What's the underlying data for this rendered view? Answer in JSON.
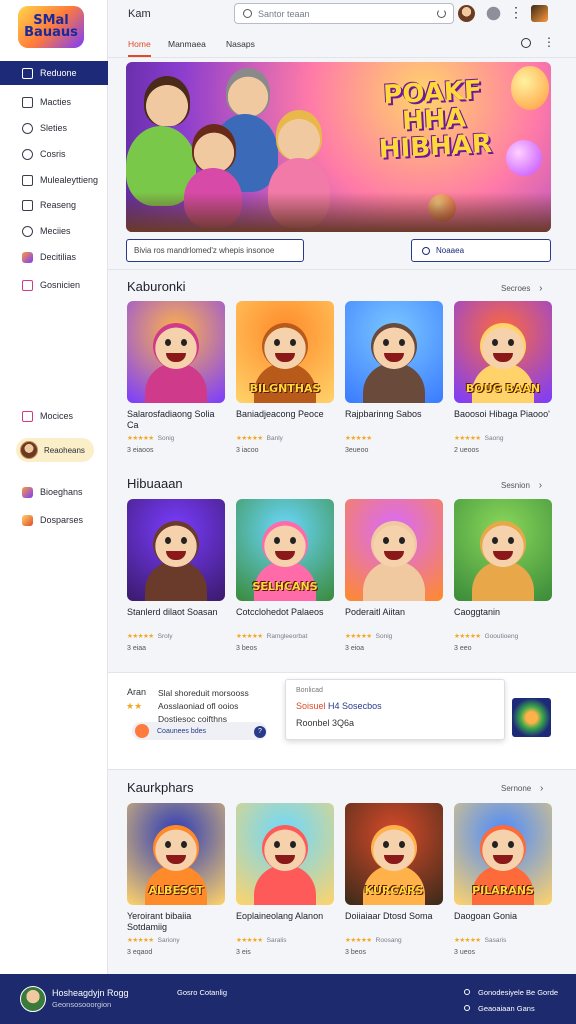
{
  "sidebar": {
    "logo_top": "SMal",
    "logo_bottom": "Bauaus",
    "items": [
      {
        "label": "Reduone",
        "icon": "home-icon"
      },
      {
        "label": "Macties",
        "icon": "grid-icon"
      },
      {
        "label": "Sleties",
        "icon": "clock-icon"
      },
      {
        "label": "Cosris",
        "icon": "chat-icon"
      },
      {
        "label": "Mulealeyttieng",
        "icon": "list-icon"
      },
      {
        "label": "Reaseng",
        "icon": "document-icon"
      },
      {
        "label": "Meciies",
        "icon": "settings-icon"
      },
      {
        "label": "Decitilias",
        "icon": "game-icon"
      },
      {
        "label": "Gosnicien",
        "icon": "book-icon"
      },
      {
        "label": "Mocices",
        "icon": "media-icon"
      },
      {
        "label": "Bioeghans",
        "icon": "game-icon"
      },
      {
        "label": "Dosparses",
        "icon": "gift-icon"
      }
    ],
    "user_label": "Reaoheans"
  },
  "topbar": {
    "brand": "Kam",
    "search_placeholder": "Santor teaan",
    "more": "⋮"
  },
  "tabs": [
    "Home",
    "Manmaea",
    "Nasaps"
  ],
  "hero": {
    "title": "POAKF HHA HIBHAR",
    "input_text": "Bivia ros mandrlomed'z whepis insonoe",
    "button_label": "Noaaea"
  },
  "sections": [
    {
      "title": "Kaburonki",
      "more": "Secroes",
      "cards": [
        {
          "title": "Salarosfadiaong Solia Ca",
          "rating": "Sonig",
          "count": "3 eiaoos",
          "art": "",
          "palette": [
            "#ffb24a",
            "#d03a8a",
            "#7a3cff"
          ]
        },
        {
          "title": "Baniadjeacong Peoce",
          "rating": "Banly",
          "count": "3 iacoo",
          "art": "BILGNTHAS",
          "palette": [
            "#ff8a2a",
            "#b85a1a",
            "#ffd36a"
          ]
        },
        {
          "title": "Rajpbarinng Sabos",
          "rating": "",
          "count": "3eueoo",
          "art": "",
          "palette": [
            "#7ac8ff",
            "#6a4a3a",
            "#3a7aff"
          ]
        },
        {
          "title": "Baoosoi Hibaga Piaooo'",
          "rating": "Saong",
          "count": "2 ueoos",
          "art": "BOUG BAAN",
          "palette": [
            "#ff6a3a",
            "#ffd36a",
            "#7a3cff"
          ]
        }
      ]
    },
    {
      "title": "Hibuaaan",
      "more": "Sesnion",
      "cards": [
        {
          "title": "Stanlerd dilaot Soasan",
          "rating": "Sroly",
          "count": "3 eiaa",
          "art": "",
          "palette": [
            "#7a3cff",
            "#6a3a2a",
            "#3a1a6a"
          ]
        },
        {
          "title": "Cotcclohedot Palaeos",
          "rating": "Ramgleeorbat",
          "count": "3 beos",
          "art": "SELHCANS",
          "palette": [
            "#6ad8ff",
            "#ff6aa8",
            "#3a8a3a"
          ]
        },
        {
          "title": "Poderaitl Aiitan",
          "rating": "Sonig",
          "count": "3 eioa",
          "art": "",
          "palette": [
            "#d86aff",
            "#f1c9a0",
            "#ff8a2a"
          ]
        },
        {
          "title": "Caoggtanin",
          "rating": "Gooutioeng",
          "count": "3 eeo",
          "art": "",
          "palette": [
            "#8ad85a",
            "#e8a84a",
            "#3a8a3a"
          ]
        }
      ]
    },
    {
      "title": "Kaurkphars",
      "more": "Sernone",
      "cards": [
        {
          "title": "Yeroirant bibaiia Sotdamiig",
          "rating": "Sariony",
          "count": "3 eqaod",
          "art": "ALBESCT",
          "palette": [
            "#2a3ab8",
            "#ff8a2a",
            "#ffd36a"
          ]
        },
        {
          "title": "Eoplaineolang Alanon",
          "rating": "Saralis",
          "count": "3 eis",
          "art": "",
          "palette": [
            "#6ad8ff",
            "#ff5a5a",
            "#ffd36a"
          ]
        },
        {
          "title": "Doiiaiaar Dtosd Soma",
          "rating": "Roosang",
          "count": "3 beos",
          "art": "KURCARS",
          "palette": [
            "#d84a2a",
            "#ffb24a",
            "#3a2a1a"
          ]
        },
        {
          "title": "Daogoan Gonia",
          "rating": "Sasaris",
          "count": "3 ueos",
          "art": "PILARANS",
          "palette": [
            "#4a8aff",
            "#ff6a3a",
            "#ffd36a"
          ]
        }
      ]
    }
  ],
  "promo": {
    "label": "Aran",
    "lines": [
      "Slal shoreduit morsooss",
      "Aosslaoniad ofl ooios",
      "Dostiesoc coifthns"
    ],
    "stars": "★★",
    "chip": "Coaunees bdes",
    "info": "?",
    "popup_line1": "Bonlicad",
    "popup_line2a": "Soisuel",
    "popup_line2b": "H4 Sosecbos",
    "popup_line3": "Roonbel 3Q6a"
  },
  "footer": {
    "name": "Hosheagdyjn Rogg",
    "sub": "Geonsosooorgion",
    "mid": "Gosro Cotanlig",
    "right1": "Gonodesiyele Be Gorde",
    "right2": "Geaoaiaan Gans"
  },
  "colors": {
    "accent": "#1d2a78",
    "tab_active": "#e04a2a",
    "star": "#f2a825"
  }
}
